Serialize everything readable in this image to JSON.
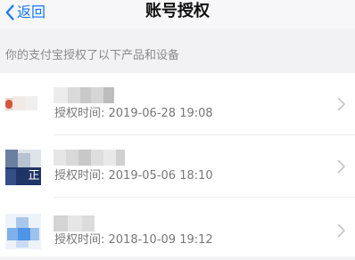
{
  "nav": {
    "back_label": "返回",
    "title": "账号授权"
  },
  "section_hint": "你的支付宝授权了以下产品和设备",
  "authorizations": [
    {
      "icon": "app-icon-red-blurred",
      "name_hidden": true,
      "time": "授权时间: 2019-06-28 19:08"
    },
    {
      "icon": "app-icon-dark-blue-blurred",
      "icon_text": "正",
      "name_hidden": true,
      "time": "授权时间: 2019-05-06 18:10"
    },
    {
      "icon": "app-icon-light-blue-blurred",
      "name_hidden": true,
      "time": "授权时间: 2018-10-09 19:12"
    }
  ],
  "colors": {
    "accent": "#1677ff",
    "background": "#f2f2f5",
    "hint_text": "#8a8a8a",
    "time_text": "#777777",
    "chevron": "#c4c4c4"
  }
}
